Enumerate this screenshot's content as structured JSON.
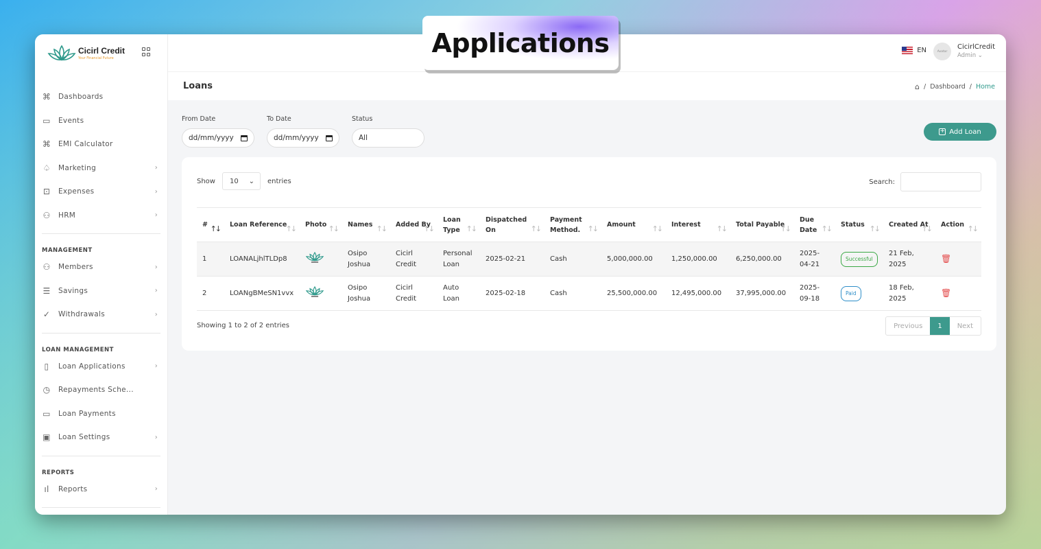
{
  "overlay_title": "Applications",
  "brand": {
    "name": "Cicirl Credit",
    "tagline": "Your Financial Future"
  },
  "sidebar": {
    "items": [
      {
        "label": "Dashboards",
        "icon": "command-icon"
      },
      {
        "label": "Events",
        "icon": "calendar-icon"
      },
      {
        "label": "EMI Calculator",
        "icon": "command-icon"
      },
      {
        "label": "Marketing",
        "icon": "bell-icon"
      },
      {
        "label": "Expenses",
        "icon": "bag-icon"
      },
      {
        "label": "HRM",
        "icon": "users-icon"
      }
    ],
    "management_label": "MANAGEMENT",
    "management_items": [
      {
        "label": "Members",
        "icon": "users-icon"
      },
      {
        "label": "Savings",
        "icon": "database-icon"
      },
      {
        "label": "Withdrawals",
        "icon": "check-circle-icon"
      }
    ],
    "loan_management_label": "LOAN MANAGEMENT",
    "loan_items": [
      {
        "label": "Loan Applications",
        "icon": "book-icon"
      },
      {
        "label": "Repayments Sche...",
        "icon": "clock-icon"
      },
      {
        "label": "Loan Payments",
        "icon": "card-icon"
      },
      {
        "label": "Loan Settings",
        "icon": "briefcase-icon"
      }
    ],
    "reports_label": "REPORTS",
    "report_items": [
      {
        "label": "Reports",
        "icon": "bar-chart-icon"
      }
    ]
  },
  "topbar": {
    "language": "EN",
    "avatar_text": "Avatar",
    "user_name": "CicirlCredit",
    "user_role": "Admin"
  },
  "page": {
    "title": "Loans",
    "breadcrumb": [
      "Dashboard",
      "Home"
    ]
  },
  "filters": {
    "from_label": "From Date",
    "from_value": "dd/mm/yyyy",
    "to_label": "To Date",
    "to_value": "dd/mm/yyyy",
    "status_label": "Status",
    "status_value": "All"
  },
  "add_button": "Add Loan",
  "table_controls": {
    "show_label": "Show",
    "entries_value": "10",
    "entries_label": "entries",
    "search_label": "Search:"
  },
  "table": {
    "headers": [
      "#",
      "Loan Reference",
      "Photo",
      "Names",
      "Added By",
      "Loan Type",
      "Dispatched On",
      "Payment Method.",
      "Amount",
      "Interest",
      "Total Payable",
      "Due Date",
      "Status",
      "Created At",
      "Action"
    ],
    "rows": [
      {
        "num": "1",
        "ref": "LOANALjhlTLDp8",
        "names": "Osipo Joshua",
        "added_by": "Cicirl Credit",
        "type": "Personal Loan",
        "dispatched": "2025-02-21",
        "method": "Cash",
        "amount": "5,000,000.00",
        "interest": "1,250,000.00",
        "total": "6,250,000.00",
        "due": "2025-04-21",
        "status": "Successful",
        "created": "21 Feb, 2025"
      },
      {
        "num": "2",
        "ref": "LOANgBMeSN1vvx",
        "names": "Osipo Joshua",
        "added_by": "Cicirl Credit",
        "type": "Auto Loan",
        "dispatched": "2025-02-18",
        "method": "Cash",
        "amount": "25,500,000.00",
        "interest": "12,495,000.00",
        "total": "37,995,000.00",
        "due": "2025-09-18",
        "status": "Paid",
        "created": "18 Feb, 2025"
      }
    ]
  },
  "footer": {
    "info": "Showing 1 to 2 of 2 entries",
    "prev": "Previous",
    "page": "1",
    "next": "Next"
  },
  "colors": {
    "accent": "#3d9a8d",
    "success": "#3aa845",
    "paid": "#2e8ec8",
    "danger": "#e34a4a"
  }
}
